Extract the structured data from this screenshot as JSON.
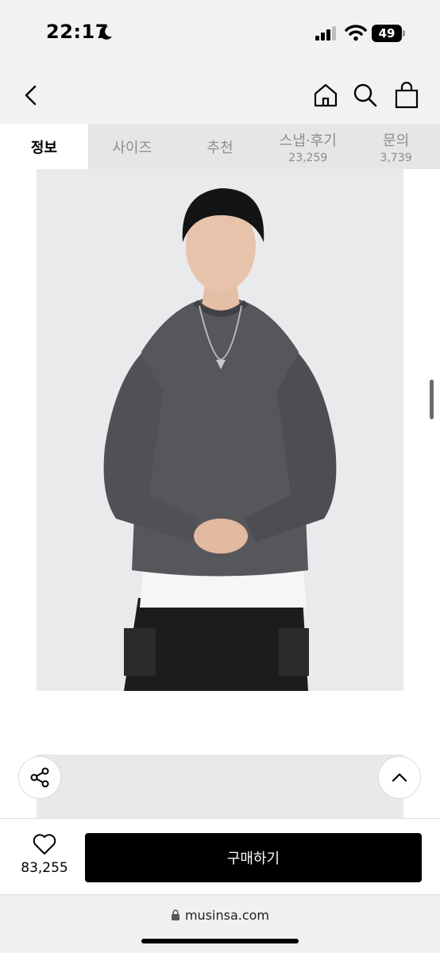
{
  "status_bar": {
    "time": "22:17",
    "battery": "49"
  },
  "tabs": [
    {
      "label": "정보",
      "count": ""
    },
    {
      "label": "사이즈",
      "count": ""
    },
    {
      "label": "추천",
      "count": ""
    },
    {
      "label": "스냅·후기",
      "count": "23,259"
    },
    {
      "label": "문의",
      "count": "3,739"
    }
  ],
  "active_tab": "정보",
  "action_bar": {
    "like_count": "83,255",
    "buy_label": "구매하기"
  },
  "browser": {
    "url": "musinsa.com"
  },
  "icons": [
    "moon-icon",
    "signal-icon",
    "wifi-icon",
    "back-icon",
    "home-icon",
    "search-icon",
    "bag-icon",
    "share-icon",
    "chevron-up-icon",
    "heart-icon",
    "lock-icon"
  ]
}
